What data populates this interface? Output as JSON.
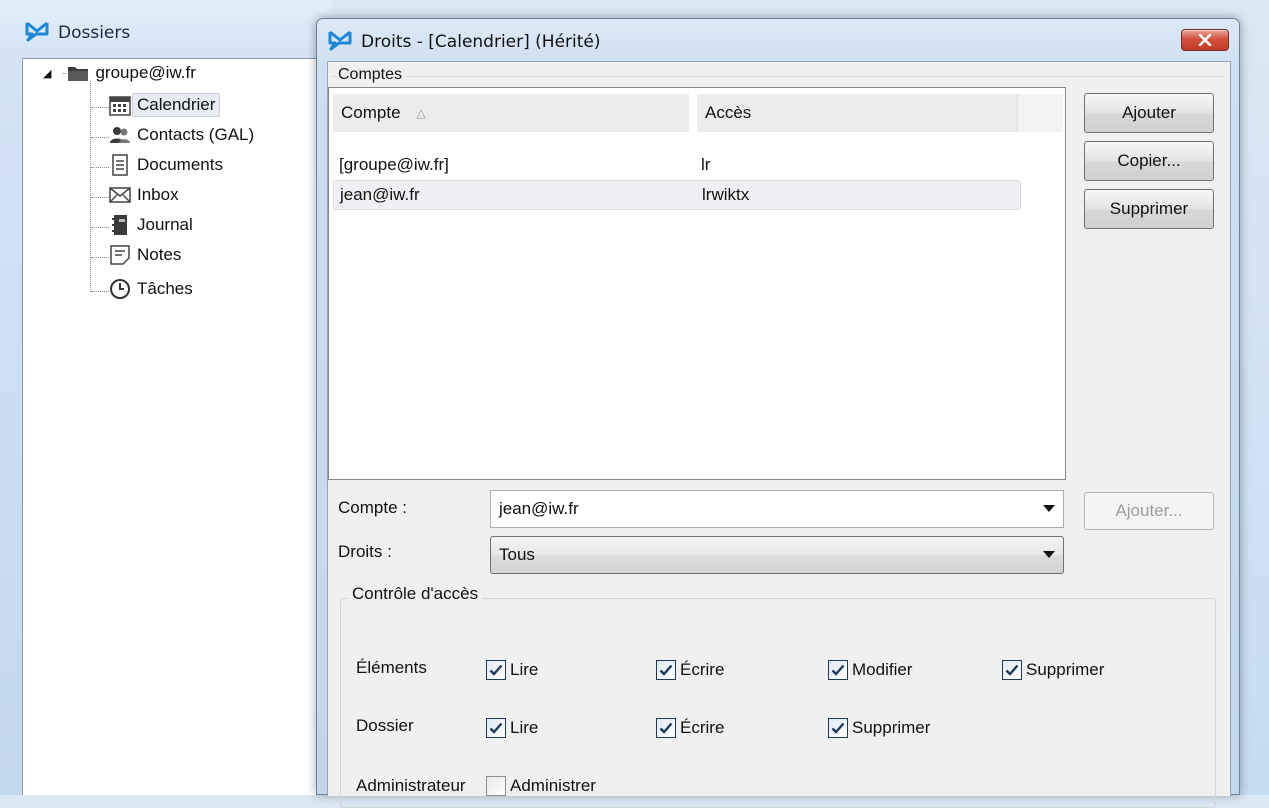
{
  "dossiers_window": {
    "title": "Dossiers",
    "tree": {
      "root": {
        "label": "groupe@iw.fr",
        "icon": "folder-icon"
      },
      "children": [
        {
          "label": "Calendrier",
          "icon": "calendar-icon",
          "selected": true
        },
        {
          "label": "Contacts (GAL)",
          "icon": "contacts-icon"
        },
        {
          "label": "Documents",
          "icon": "document-icon"
        },
        {
          "label": "Inbox",
          "icon": "envelope-icon"
        },
        {
          "label": "Journal",
          "icon": "journal-icon"
        },
        {
          "label": "Notes",
          "icon": "note-icon"
        },
        {
          "label": "Tâches",
          "icon": "clock-icon"
        }
      ]
    }
  },
  "dialog": {
    "title": "Droits - [Calendrier] (Hérité)",
    "comptes_group": "Comptes",
    "list": {
      "columns": [
        "Compte",
        "Accès"
      ],
      "sort_indicator": "△",
      "rows": [
        {
          "compte": "[groupe@iw.fr]",
          "acces": "lr"
        },
        {
          "compte": "jean@iw.fr",
          "acces": "lrwiktx",
          "selected": true
        }
      ]
    },
    "buttons": {
      "ajouter": "Ajouter",
      "copier": "Copier...",
      "supprimer": "Supprimer",
      "ajouter_compte": "Ajouter..."
    },
    "form": {
      "compte_label": "Compte :",
      "compte_value": "jean@iw.fr",
      "droits_label": "Droits :",
      "droits_value": "Tous"
    },
    "access_control": {
      "title": "Contrôle d'accès",
      "elements": {
        "label": "Éléments",
        "lire": "Lire",
        "ecrire": "Écrire",
        "modifier": "Modifier",
        "supprimer": "Supprimer"
      },
      "dossier": {
        "label": "Dossier",
        "lire": "Lire",
        "ecrire": "Écrire",
        "supprimer": "Supprimer"
      },
      "administrateur": {
        "label": "Administrateur",
        "administrer": "Administrer"
      }
    }
  },
  "colors": {
    "title_gradient_top": "#dde9f6",
    "close_button": "#c23a24",
    "dialog_body": "#f0f0f0",
    "check_mark": "#1e395b"
  }
}
